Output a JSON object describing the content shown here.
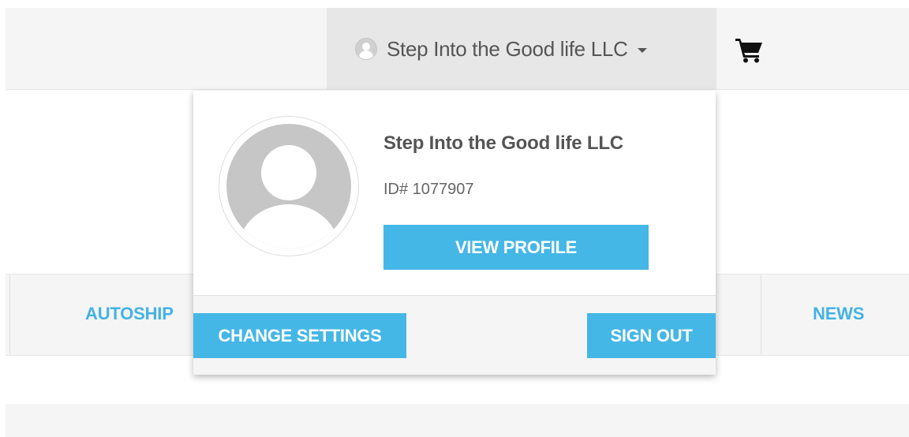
{
  "header": {
    "user_name": "Step Into the Good life LLC",
    "cart_icon": "shopping-cart-icon",
    "avatar_icon": "user-avatar-icon"
  },
  "nav": {
    "items": [
      {
        "label": "AUTOSHIP"
      },
      {
        "label": "NEWS"
      }
    ]
  },
  "dropdown": {
    "profile_name": "Step Into the Good life LLC",
    "profile_id": "ID# 1077907",
    "view_profile_label": "VIEW PROFILE",
    "change_settings_label": "CHANGE SETTINGS",
    "sign_out_label": "SIGN OUT"
  },
  "colors": {
    "accent": "#45b7e6",
    "nav_link": "#45b2e4",
    "header_bg": "#f5f5f5",
    "toggle_bg": "#e7e7e7",
    "text": "#555555"
  }
}
